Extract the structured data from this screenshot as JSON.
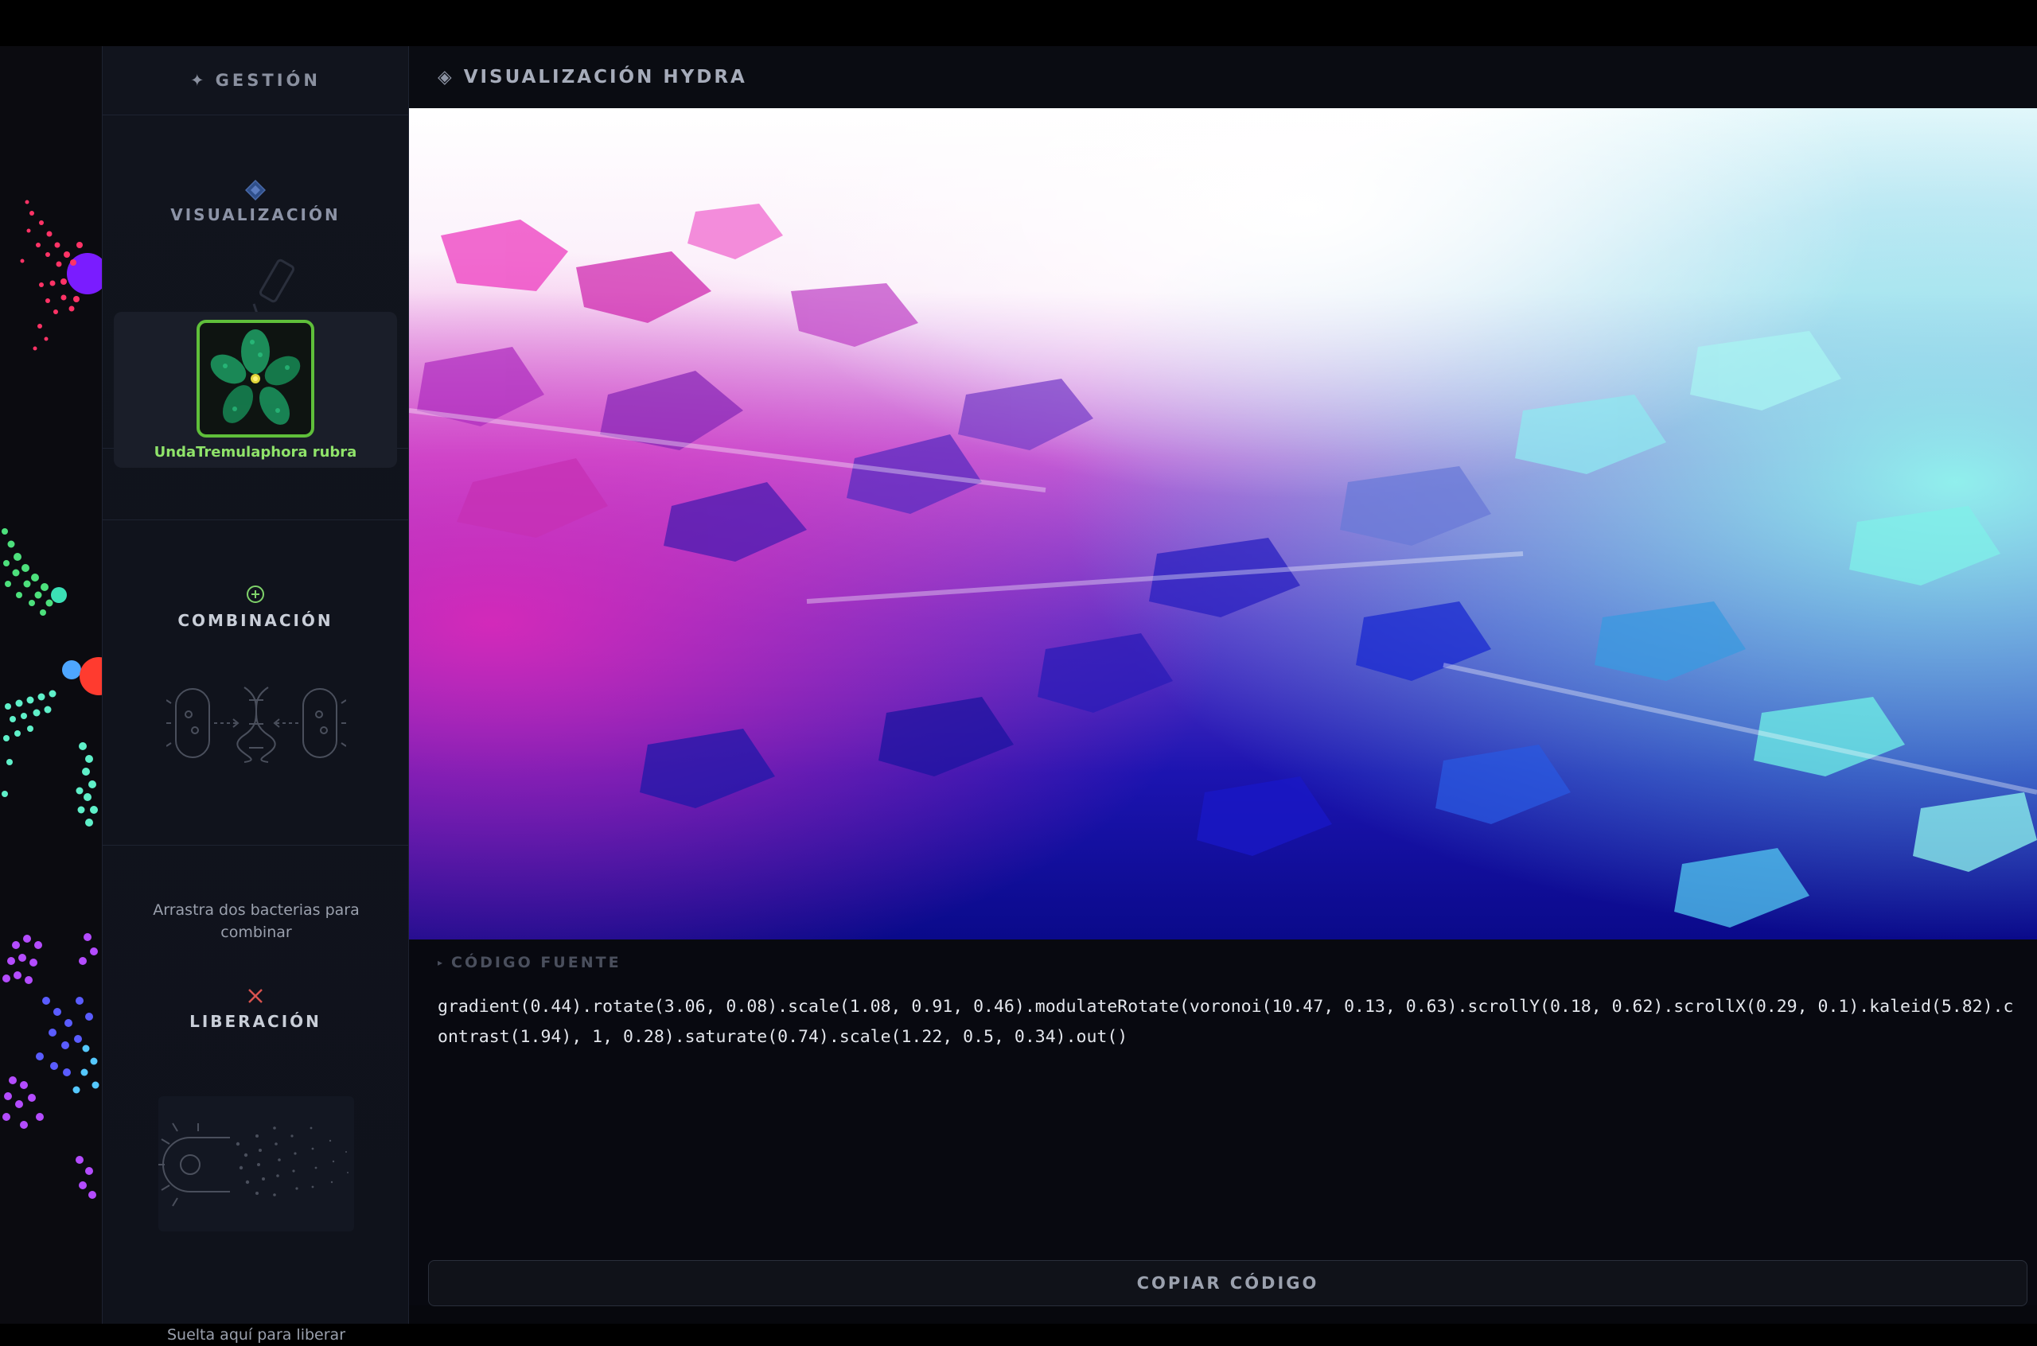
{
  "sidebar": {
    "title": "GESTIÓN",
    "visualization": {
      "title": "VISUALIZACIÓN",
      "selected_bacteria": "UndaTremulaphora rubra",
      "selected_border_color": "#5fbf3a"
    },
    "combination": {
      "title": "COMBINACIÓN",
      "hint": "Arrastra dos bacterias para combinar"
    },
    "liberation": {
      "title": "LIBERACIÓN",
      "hint": "Suelta aquí para liberar"
    }
  },
  "main": {
    "title": "VISUALIZACIÓN HYDRA",
    "code_label": "CÓDIGO FUENTE",
    "code": "gradient(0.44).rotate(3.06, 0.08).scale(1.08, 0.91, 0.46).modulateRotate(voronoi(10.47, 0.13, 0.63).scrollY(0.18, 0.62).scrollX(0.29, 0.1).kaleid(5.82).contrast(1.94), 1, 0.28).saturate(0.74).scale(1.22, 0.5, 0.34).out()",
    "copy_button": "COPIAR CÓDIGO"
  },
  "icons": {
    "header": "sparkle-icon",
    "visualization": "diamond-icon",
    "combination": "plus-circle-icon",
    "liberation": "x-icon",
    "main_title": "diamond-outline-icon"
  },
  "colors": {
    "accent_green": "#8fe36a",
    "liberation_icon": "#d9534f",
    "combination_icon": "#7fd26a",
    "visualization_icon": "#4a6aa8"
  }
}
